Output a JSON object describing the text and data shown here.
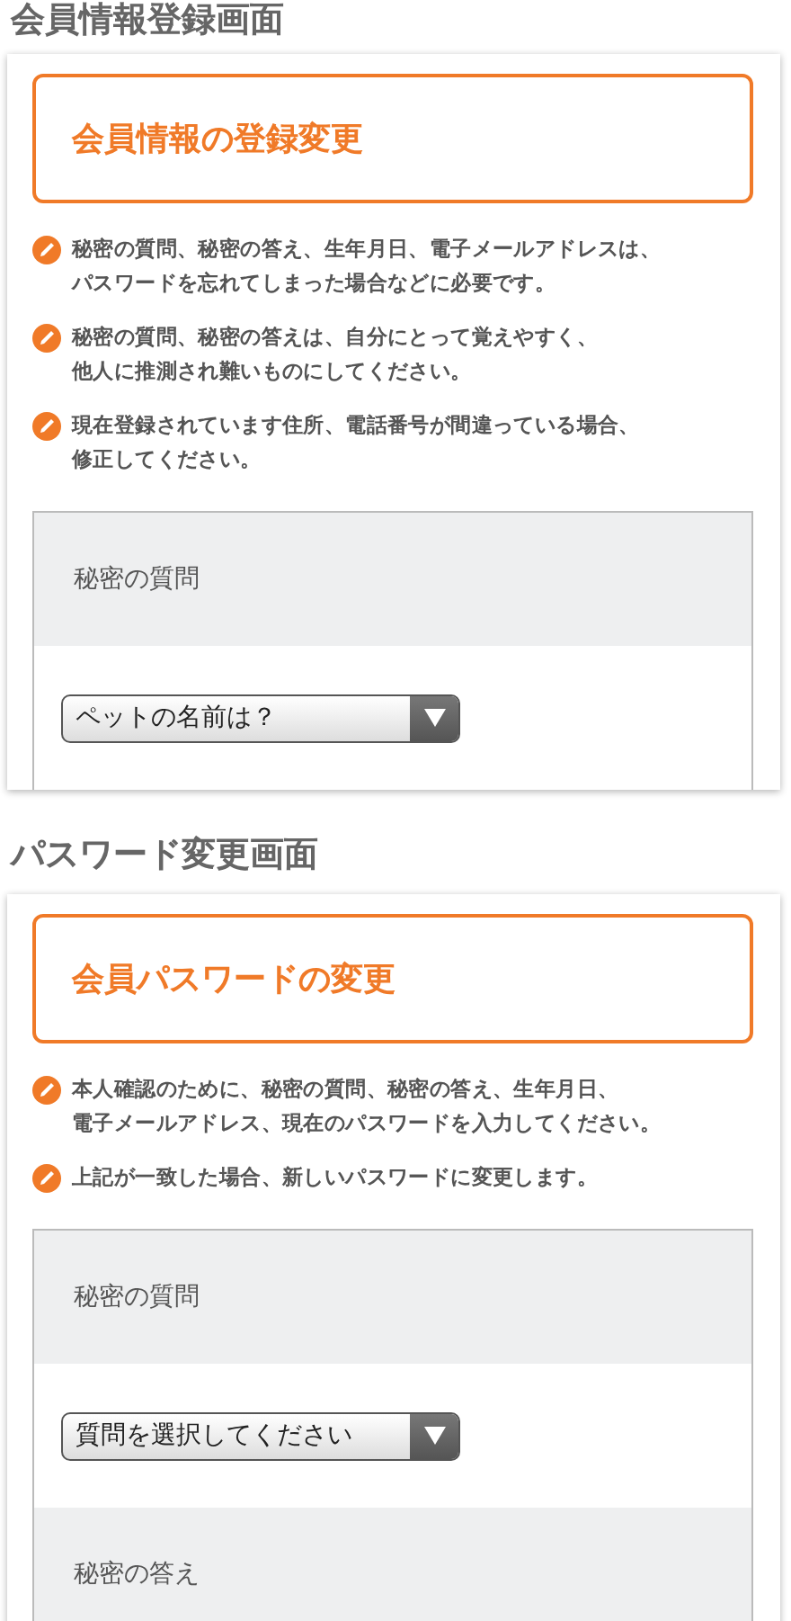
{
  "sections": [
    {
      "heading": "会員情報登録画面",
      "title": "会員情報の登録変更",
      "notes": [
        {
          "lines": [
            "秘密の質問、秘密の答え、生年月日、電子メールアドレスは、",
            "パスワードを忘れてしまった場合などに必要です。"
          ]
        },
        {
          "lines": [
            "秘密の質問、秘密の答えは、自分にとって覚えやすく、",
            "他人に推測され難いものにしてください。"
          ]
        },
        {
          "lines": [
            "現在登録されています住所、電話番号が間違っている場合、",
            "修正してください。"
          ]
        }
      ],
      "form": [
        {
          "kind": "label",
          "text": "秘密の質問"
        },
        {
          "kind": "select",
          "value": "ペットの名前は？"
        }
      ]
    },
    {
      "heading": "パスワード変更画面",
      "title": "会員パスワードの変更",
      "notes": [
        {
          "lines": [
            "本人確認のために、秘密の質問、秘密の答え、生年月日、",
            "電子メールアドレス、現在のパスワードを入力してください。"
          ]
        },
        {
          "lines": [
            "上記が一致した場合、新しいパスワードに変更します。"
          ]
        }
      ],
      "form": [
        {
          "kind": "label",
          "text": "秘密の質問"
        },
        {
          "kind": "select",
          "value": "質問を選択してください"
        },
        {
          "kind": "label",
          "text": "秘密の答え"
        }
      ]
    }
  ]
}
